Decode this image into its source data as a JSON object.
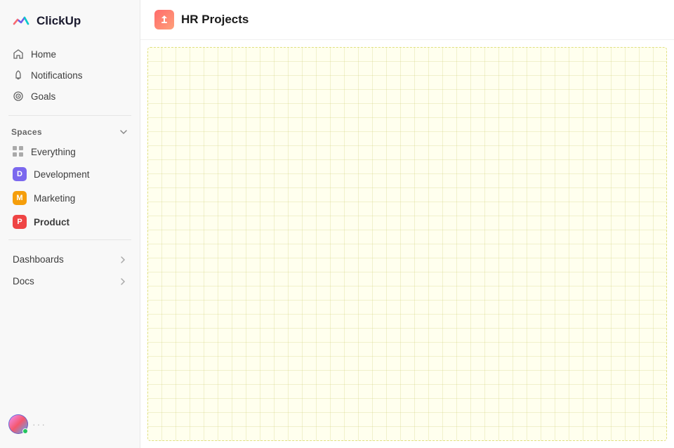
{
  "app": {
    "name": "ClickUp"
  },
  "sidebar": {
    "nav": [
      {
        "id": "home",
        "label": "Home",
        "icon": "home-icon"
      },
      {
        "id": "notifications",
        "label": "Notifications",
        "icon": "bell-icon"
      },
      {
        "id": "goals",
        "label": "Goals",
        "icon": "target-icon"
      }
    ],
    "spaces_label": "Spaces",
    "spaces": [
      {
        "id": "everything",
        "label": "Everything",
        "type": "grid"
      },
      {
        "id": "development",
        "label": "Development",
        "type": "badge",
        "badge": "D",
        "color": "badge-d"
      },
      {
        "id": "marketing",
        "label": "Marketing",
        "type": "badge",
        "badge": "M",
        "color": "badge-m"
      },
      {
        "id": "product",
        "label": "Product",
        "type": "badge",
        "badge": "P",
        "color": "badge-p",
        "active": true
      }
    ],
    "sections": [
      {
        "id": "dashboards",
        "label": "Dashboards"
      },
      {
        "id": "docs",
        "label": "Docs"
      }
    ]
  },
  "header": {
    "title": "HR Projects"
  }
}
